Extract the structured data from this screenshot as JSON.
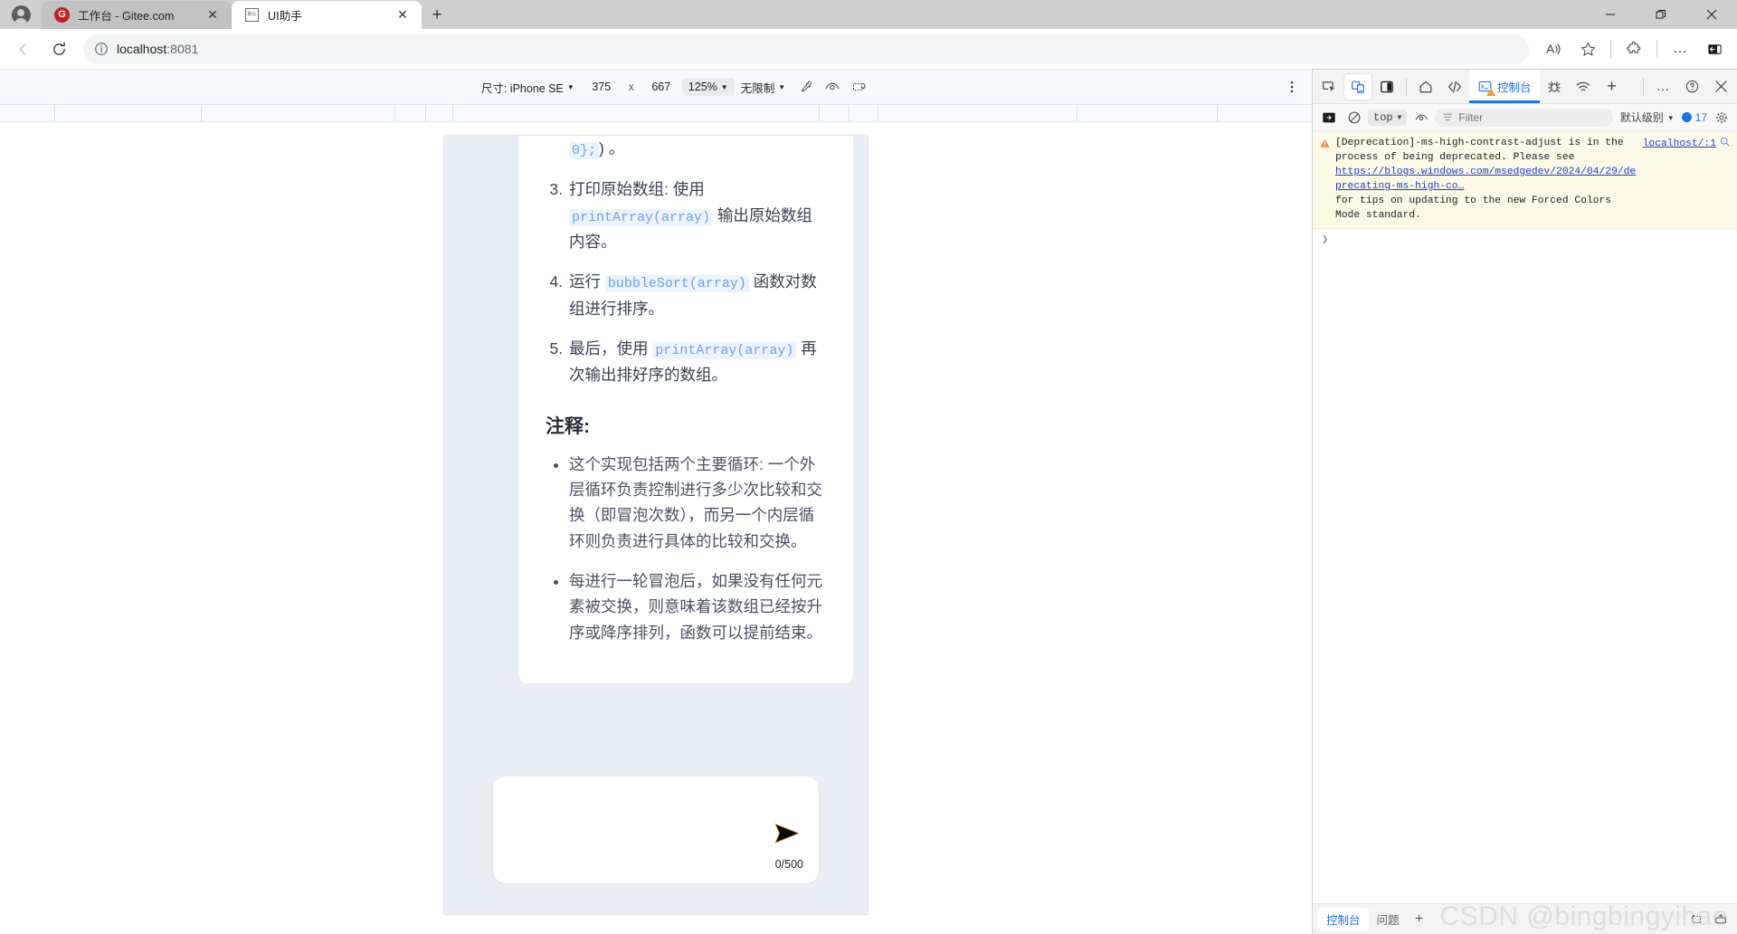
{
  "browser": {
    "tabs": [
      {
        "title": "工作台 - Gitee.com",
        "favicon": "gitee-icon",
        "active": false
      },
      {
        "title": "UI助手",
        "favicon": "document-icon",
        "active": true
      }
    ],
    "new_tab_label": "+",
    "window_controls": {
      "minimize": "–",
      "restore": "❐",
      "close": "✕"
    },
    "toolbar": {
      "back": "back-arrow-icon",
      "reload": "reload-icon",
      "url_prefix": "localhost",
      "url_port": ":8081",
      "info_icon": "info-icon",
      "read_aloud": "read-aloud-icon",
      "favorite": "star-icon",
      "extensions": "extensions-icon",
      "settings_more": "…",
      "sidebar": "sidebar-icon"
    }
  },
  "device_toolbar": {
    "size_label": "尺寸: iPhone SE",
    "width": "375",
    "times": "x",
    "height": "667",
    "zoom": "125%",
    "throttling": "无限制",
    "rotate_icon": "eyedropper-icon",
    "eye_icon": "eye-icon",
    "screenshot_icon": "capture-screenshot-icon",
    "more_icon": "more-options-icon"
  },
  "app": {
    "list_fragment_top": {
      "code": "0};",
      "tail": ") 。"
    },
    "ordered_items": [
      {
        "number": "3.",
        "parts": [
          {
            "type": "text",
            "value": "打印原始数组: 使用 "
          },
          {
            "type": "code",
            "value": "printArray(array)"
          },
          {
            "type": "text",
            "value": " 输出原始数组内容。"
          }
        ]
      },
      {
        "number": "4.",
        "parts": [
          {
            "type": "text",
            "value": "运行 "
          },
          {
            "type": "code",
            "value": "bubbleSort(array)"
          },
          {
            "type": "text",
            "value": " 函数对数组进行排序。"
          }
        ]
      },
      {
        "number": "5.",
        "parts": [
          {
            "type": "text",
            "value": "最后，使用 "
          },
          {
            "type": "code",
            "value": "printArray(array)"
          },
          {
            "type": "text",
            "value": " 再次输出排好序的数组。"
          }
        ]
      }
    ],
    "notes_title": "注释:",
    "notes": [
      "这个实现包括两个主要循环: 一个外层循环负责控制进行多少次比较和交换（即冒泡次数），而另一个内层循环则负责进行具体的比较和交换。",
      "每进行一轮冒泡后，如果没有任何元素被交换，则意味着该数组已经按升序或降序排列，函数可以提前结束。"
    ],
    "composer": {
      "placeholder": "",
      "value": "",
      "counter": "0/500",
      "send_icon": "send-icon"
    }
  },
  "devtools": {
    "tabbar": {
      "inspect_icon": "inspect-element-icon",
      "device_toggle_icon": "device-toolbar-icon",
      "panel_icon": "panel-layout-icon",
      "home_icon": "home-icon",
      "elements_icon": "elements-code-icon",
      "console_tab": "控制台",
      "console_has_warning": true,
      "bug_icon": "bug-icon",
      "network_icon": "network-icon",
      "add_icon": "+",
      "more_icon": "…",
      "help_icon": "?",
      "close_icon": "✕"
    },
    "filterbar": {
      "sidebar_toggle_icon": "console-sidebar-icon",
      "clear_icon": "clear-console-icon",
      "context": "top",
      "live_expression_icon": "eye-icon",
      "filter_placeholder": "Filter",
      "filter_value": "",
      "level": "默认级别",
      "issues_count": "17",
      "settings_icon": "gear-icon"
    },
    "console_messages": [
      {
        "severity": "warning",
        "line1": "[Deprecation]-ms-high-contrast-adjust is in the",
        "line2": "process of being deprecated. Please see",
        "link": "https://blogs.windows.com/msedgedev/2024/04/29/deprecating-ms-high-co…",
        "line4": "for tips on updating to the new Forced Colors Mode standard.",
        "source": "localhost/:1",
        "source_icon": "search-icon"
      }
    ],
    "prompt_symbol": "❯",
    "drawer": {
      "tabs": [
        {
          "label": "控制台",
          "active": true
        },
        {
          "label": "问题",
          "active": false
        }
      ],
      "add_label": "+",
      "right_icons": [
        "dock-icon",
        "export-icon"
      ]
    }
  },
  "watermark": "CSDN @bingbingyihao"
}
